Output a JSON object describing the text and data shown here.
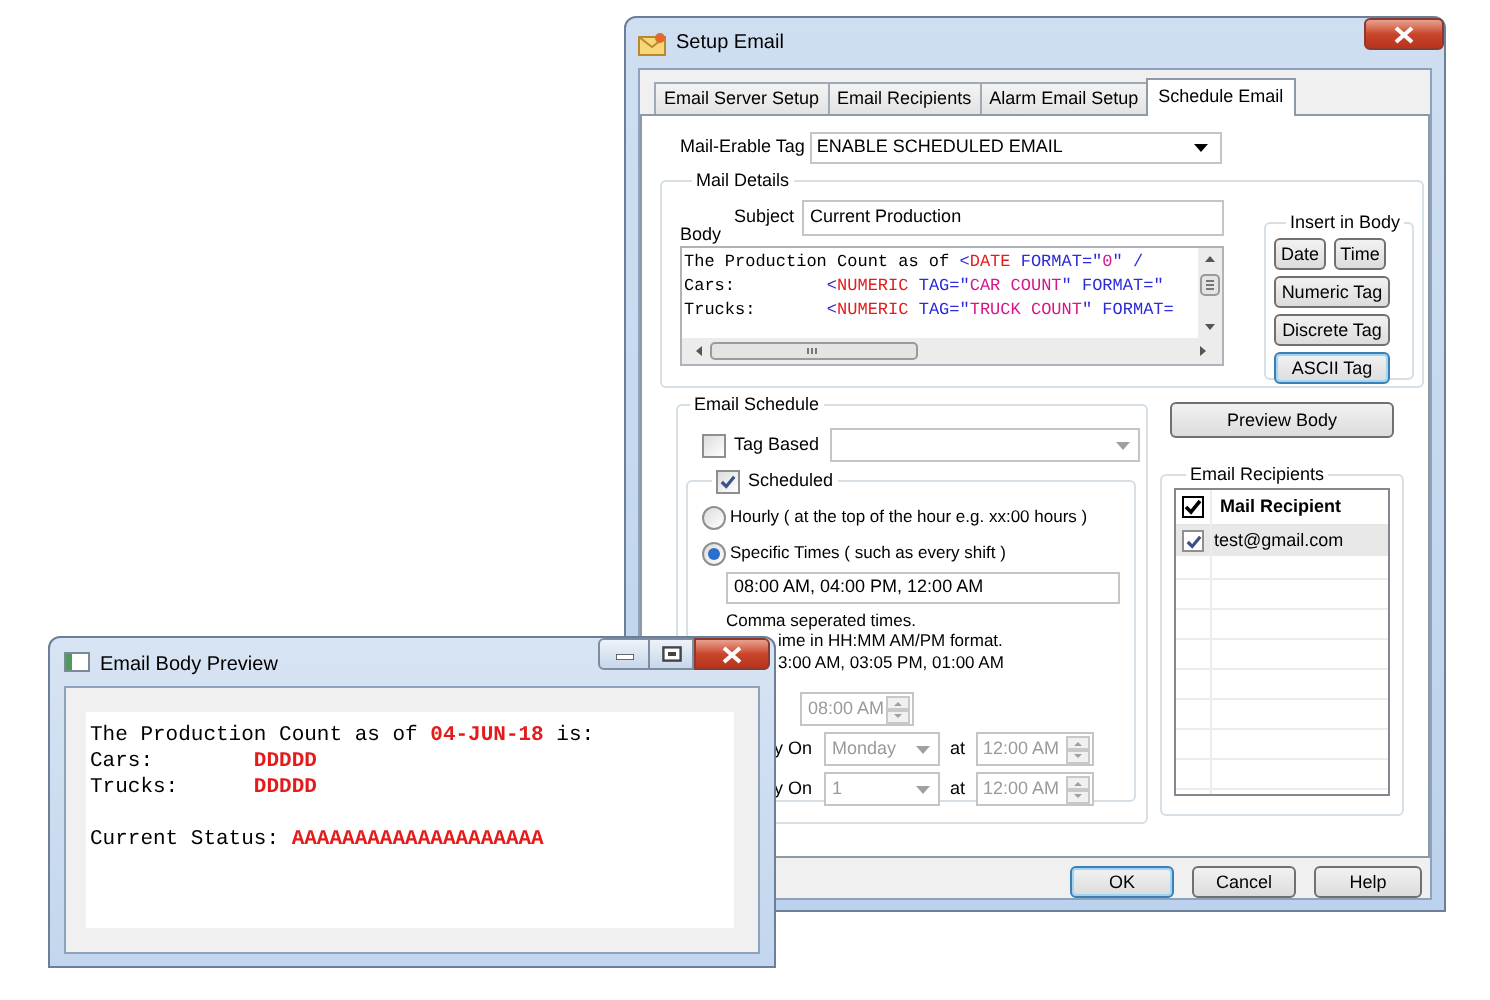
{
  "setup_window": {
    "title": "Setup Email",
    "tabs": [
      {
        "label": "Email Server Setup",
        "selected": false
      },
      {
        "label": "Email Recipients",
        "selected": false
      },
      {
        "label": "Alarm Email Setup",
        "selected": false
      },
      {
        "label": "Schedule Email",
        "selected": true
      }
    ],
    "mail_enable_tag": {
      "label": "Mail-Erable Tag",
      "value": "ENABLE SCHEDULED EMAIL"
    },
    "mail_details": {
      "title": "Mail Details",
      "subject_label": "Subject",
      "subject": "Current Production",
      "body_label": "Body",
      "body_lines": [
        [
          {
            "text": "The Production Count as of ",
            "color": "#000000"
          },
          {
            "text": "<",
            "color": "#2b2bd8"
          },
          {
            "text": "DATE",
            "color": "#e41b1b"
          },
          {
            "text": " FORMAT=\"",
            "color": "#2b2bd8"
          },
          {
            "text": "0",
            "color": "#d6168b"
          },
          {
            "text": "\" /",
            "color": "#2b2bd8"
          }
        ],
        [
          {
            "text": "Cars:         ",
            "color": "#000000"
          },
          {
            "text": "<",
            "color": "#2b2bd8"
          },
          {
            "text": "NUMERIC",
            "color": "#e41b1b"
          },
          {
            "text": " TAG=\"",
            "color": "#2b2bd8"
          },
          {
            "text": "CAR COUNT",
            "color": "#d6168b"
          },
          {
            "text": "\" FORMAT=\"",
            "color": "#2b2bd8"
          }
        ],
        [
          {
            "text": "Trucks:       ",
            "color": "#000000"
          },
          {
            "text": "<",
            "color": "#2b2bd8"
          },
          {
            "text": "NUMERIC",
            "color": "#e41b1b"
          },
          {
            "text": " TAG=\"",
            "color": "#2b2bd8"
          },
          {
            "text": "TRUCK COUNT",
            "color": "#d6168b"
          },
          {
            "text": "\" FORMAT=",
            "color": "#2b2bd8"
          }
        ]
      ]
    },
    "insert_in_body": {
      "title": "Insert in Body",
      "buttons": [
        {
          "label": "Date",
          "focused": false
        },
        {
          "label": "Time",
          "focused": false
        },
        {
          "label": "Numeric Tag",
          "focused": false
        },
        {
          "label": "Discrete Tag",
          "focused": false
        },
        {
          "label": "ASCII Tag",
          "focused": true
        }
      ]
    },
    "email_schedule": {
      "title": "Email Schedule",
      "tag_based": {
        "label": "Tag Based",
        "checked": false
      },
      "scheduled": {
        "label": "Scheduled",
        "checked": true
      },
      "options": [
        {
          "label": "Hourly ( at the top of the hour e.g. xx:00 hours )",
          "selected": false
        },
        {
          "label": "Specific Times ( such as every shift )",
          "selected": true
        }
      ],
      "times": "08:00 AM, 04:00 PM, 12:00 AM",
      "hint_lines": [
        "Comma seperated times.",
        "ime in HH:MM AM/PM format.",
        "3:00 AM, 03:05 PM, 01:00 AM"
      ],
      "daily": {
        "time": "08:00 AM",
        "disabled": true
      },
      "weekly": {
        "label": "y On",
        "day": "Monday",
        "at": "at",
        "time": "12:00 AM",
        "disabled": true
      },
      "monthly": {
        "label": "y On",
        "day": "1",
        "at": "at",
        "time": "12:00 AM",
        "disabled": true
      }
    },
    "preview_button": "Preview Body",
    "email_recipients": {
      "title": "Email Recipients",
      "all_checked": true,
      "column": "Mail Recipient",
      "rows": [
        {
          "email": "test@gmail.com",
          "checked": true,
          "selected": true
        }
      ]
    },
    "buttons": [
      {
        "label": "OK",
        "focused": true
      },
      {
        "label": "Cancel",
        "focused": false
      },
      {
        "label": "Help",
        "focused": false
      }
    ]
  },
  "preview_window": {
    "title": "Email Body Preview",
    "paragraphs": [
      [
        [
          {
            "text": "The Production Count as of ",
            "color": "#000000",
            "bold": false
          },
          {
            "text": "04-JUN-18",
            "color": "#e41b1b",
            "bold": true
          },
          {
            "text": " is:",
            "color": "#000000",
            "bold": false
          }
        ],
        [
          {
            "text": "Cars:        ",
            "color": "#000000",
            "bold": false
          },
          {
            "text": "DDDDD",
            "color": "#e41b1b",
            "bold": true
          }
        ],
        [
          {
            "text": "Trucks:      ",
            "color": "#000000",
            "bold": false
          },
          {
            "text": "DDDDD",
            "color": "#e41b1b",
            "bold": true
          }
        ]
      ],
      [
        [
          {
            "text": "Current Status: ",
            "color": "#000000",
            "bold": false
          },
          {
            "text": "AAAAAAAAAAAAAAAAAAAA",
            "color": "#e41b1b",
            "bold": true
          }
        ]
      ]
    ]
  }
}
